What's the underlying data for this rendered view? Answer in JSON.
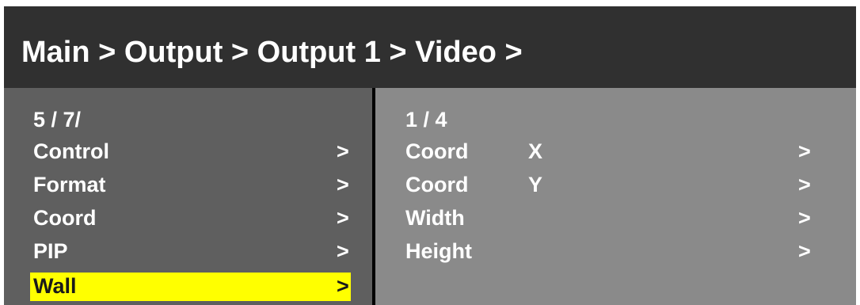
{
  "breadcrumb": "Main > Output > Output 1 > Video >",
  "left_menu": {
    "position": "5 / 7/",
    "items": [
      {
        "label": "Control",
        "arrow": ">"
      },
      {
        "label": "Format",
        "arrow": ">"
      },
      {
        "label": "Coord",
        "arrow": ">"
      },
      {
        "label": "PIP",
        "arrow": ">"
      },
      {
        "label": "Wall",
        "arrow": ">",
        "selected": true
      }
    ]
  },
  "right_menu": {
    "position": "1 / 4",
    "items": [
      {
        "label": "Coord",
        "value": "X",
        "arrow": ">"
      },
      {
        "label": "Coord",
        "value": "Y",
        "arrow": ">"
      },
      {
        "label": "Width",
        "value": "",
        "arrow": ">"
      },
      {
        "label": "Height",
        "value": "",
        "arrow": ">"
      }
    ]
  },
  "colors": {
    "header_bg": "#303030",
    "left_panel_bg": "#5f5f5f",
    "right_panel_bg": "#8a8a8a",
    "selection": "#ffff00"
  }
}
